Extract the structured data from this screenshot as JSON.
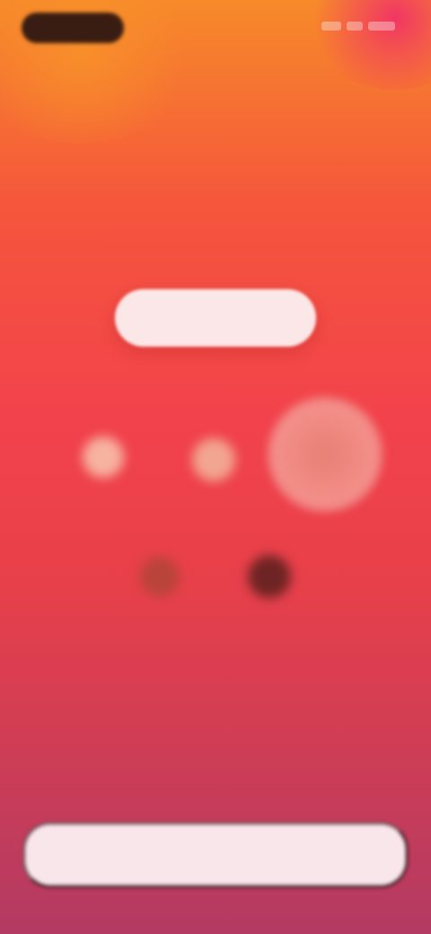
{
  "status_bar": {
    "time": "",
    "icons": [
      "signal-icon",
      "wifi-icon",
      "battery-icon"
    ]
  },
  "header": {
    "eyebrow": "",
    "headline": "",
    "description": ""
  },
  "actions": {
    "pill_button_label": "",
    "bottom_button_label": ""
  },
  "colors": {
    "gradient_top": "#f78a2a",
    "gradient_mid": "#f2424c",
    "gradient_bottom": "#b33a63",
    "pill_button": "#fbe7e7",
    "bottom_button": "#f9e6ea"
  },
  "dots": [
    {
      "name": "dot-light-1",
      "color": "#f7b2a0"
    },
    {
      "name": "dot-light-2",
      "color": "#f2a591"
    },
    {
      "name": "ring-large",
      "color": "#f08a82"
    },
    {
      "name": "dot-dark-1",
      "color": "#b9443a"
    },
    {
      "name": "dot-dark-2",
      "color": "#6e2424"
    }
  ]
}
